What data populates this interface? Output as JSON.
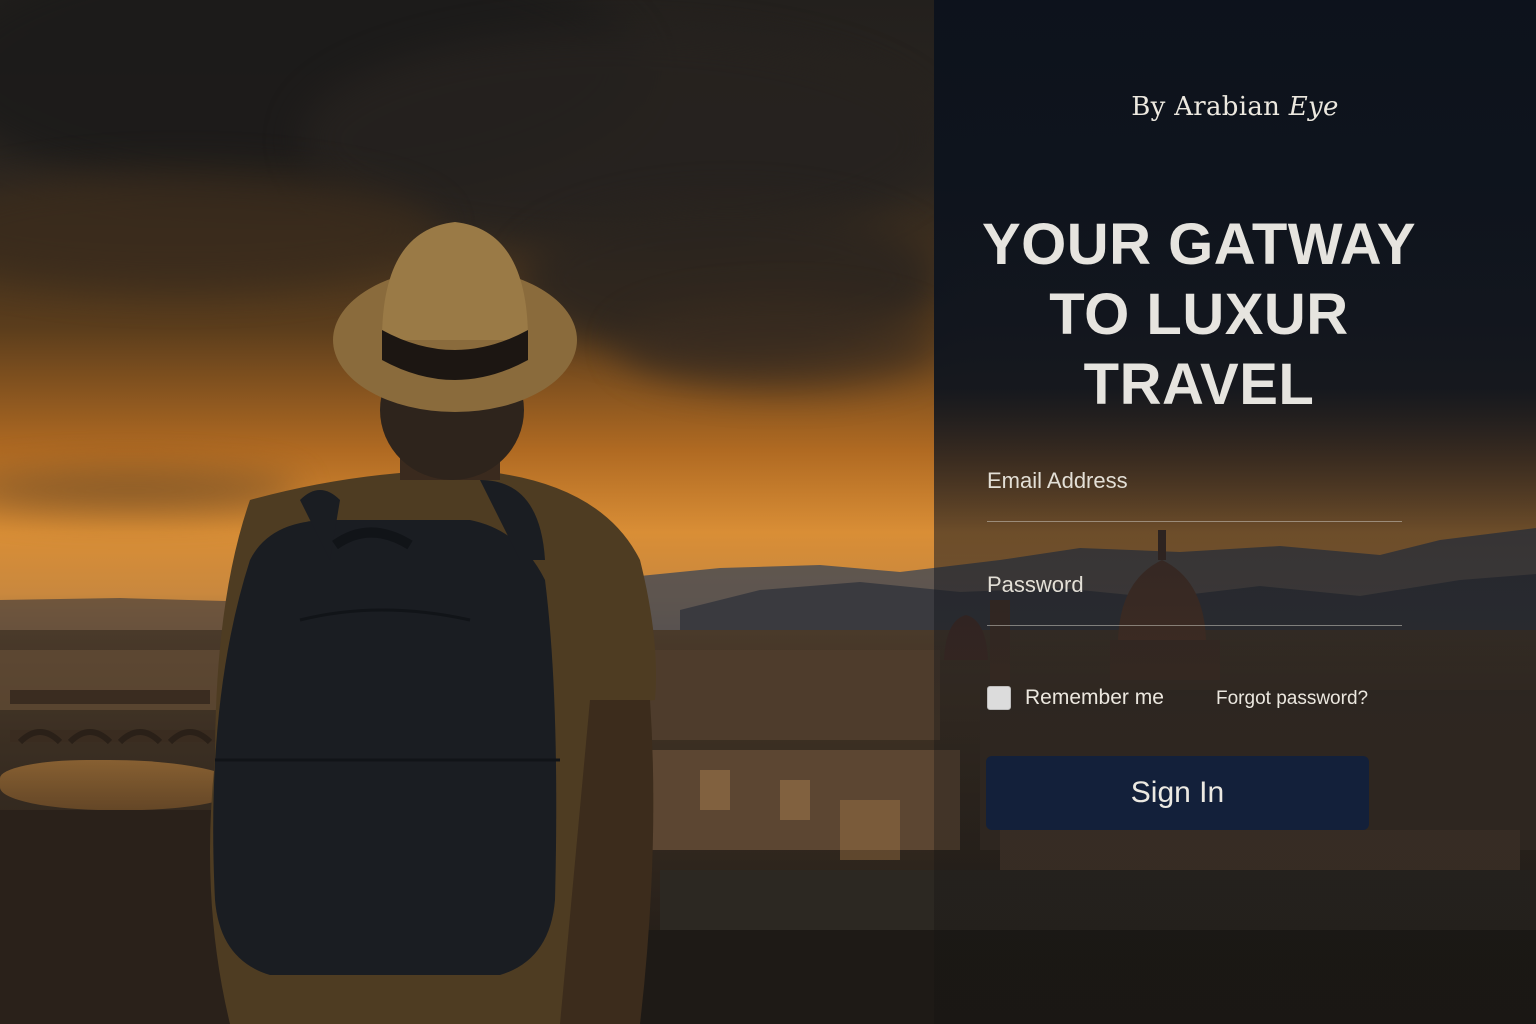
{
  "brand": {
    "prefix": "By Arabian ",
    "suffix": "Eye"
  },
  "headline": {
    "line1": "YOUR GATWAY",
    "line2": "TO LUXUR TRAVEL"
  },
  "form": {
    "email_label": "Email Address",
    "email_value": "",
    "password_label": "Password",
    "password_value": "",
    "remember_label": "Remember me",
    "remember_checked": false,
    "forgot_label": "Forgot password?",
    "signin_label": "Sign In"
  },
  "colors": {
    "panel": "#0c121c",
    "button": "#13203a",
    "text": "#e6e4df"
  }
}
